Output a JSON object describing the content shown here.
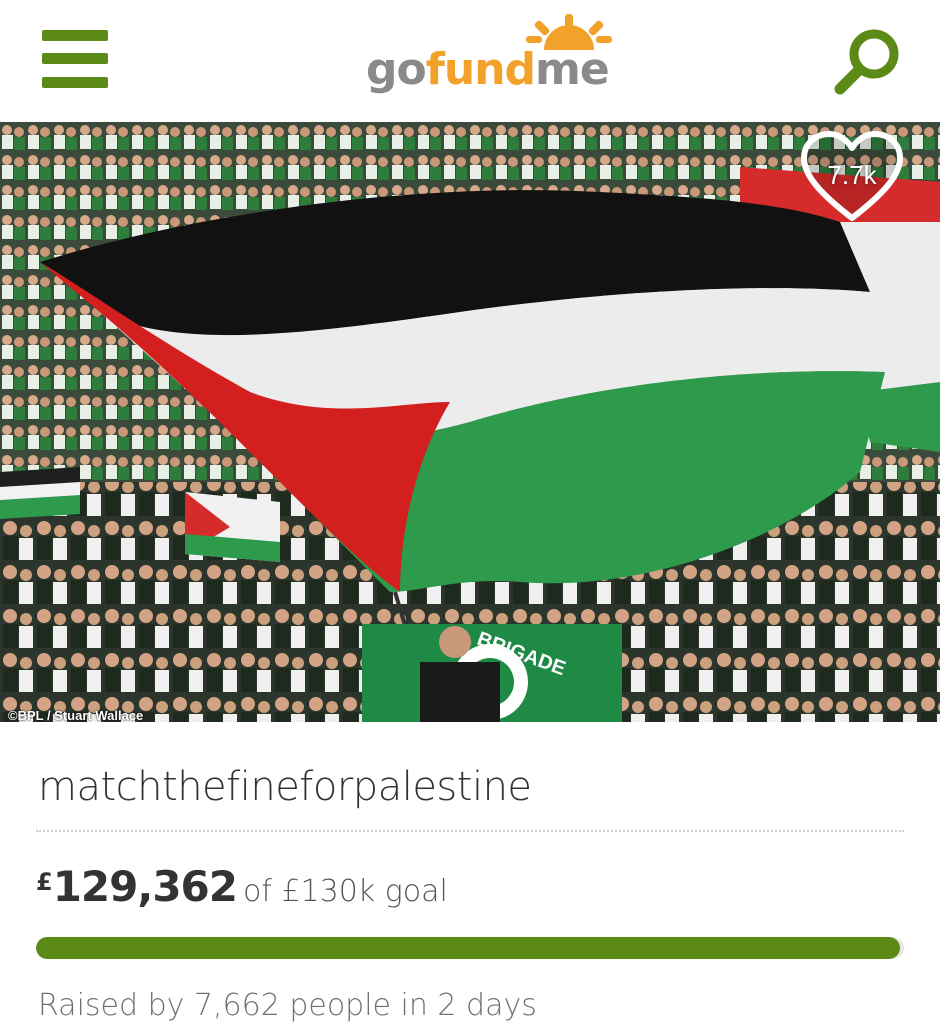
{
  "header": {
    "logo": {
      "part_go": "go",
      "part_fund": "fund",
      "part_me": "me"
    },
    "menu_icon": "hamburger-menu-icon",
    "search_icon": "search-icon",
    "accent_color": "#5b8a17"
  },
  "hero": {
    "like_count": "7.7k",
    "like_icon": "heart-icon",
    "photo_credit": "©BPL / Stuart Wallace",
    "banner_text": "BRIGADE"
  },
  "campaign": {
    "title": "matchthefineforpalestine",
    "currency_symbol": "£",
    "amount_raised": "129,362",
    "goal_text": "of £130k goal",
    "progress_fraction": 0.995,
    "raised_text": "Raised by 7,662 people in 2 days"
  }
}
